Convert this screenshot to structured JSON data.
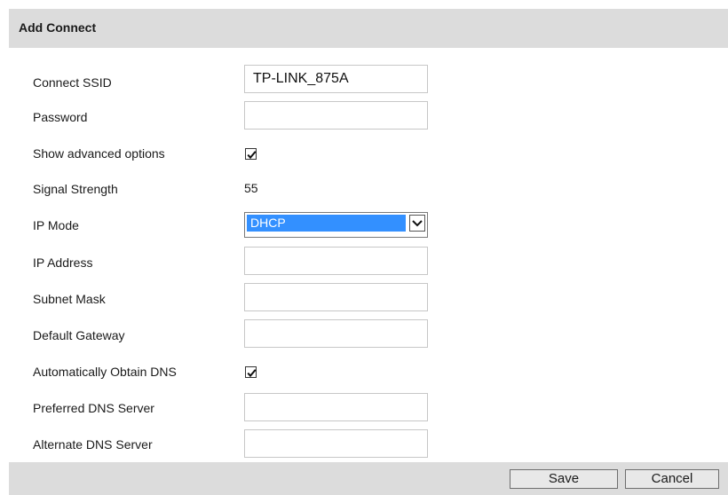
{
  "dialog": {
    "title": "Add Connect"
  },
  "form": {
    "ssid": {
      "label": "Connect SSID",
      "value": "TP-LINK_875A"
    },
    "password": {
      "label": "Password",
      "value": ""
    },
    "show_advanced": {
      "label": "Show advanced options",
      "checked": true
    },
    "signal_strength": {
      "label": "Signal Strength",
      "value": "55"
    },
    "ip_mode": {
      "label": "IP Mode",
      "value": "DHCP",
      "options": [
        "DHCP"
      ]
    },
    "ip_address": {
      "label": "IP Address",
      "value": ""
    },
    "subnet_mask": {
      "label": "Subnet Mask",
      "value": ""
    },
    "default_gateway": {
      "label": "Default Gateway",
      "value": ""
    },
    "auto_dns": {
      "label": "Automatically Obtain DNS",
      "checked": true
    },
    "preferred_dns": {
      "label": "Preferred DNS Server",
      "value": ""
    },
    "alternate_dns": {
      "label": "Alternate DNS Server",
      "value": ""
    }
  },
  "footer": {
    "save_label": "Save",
    "cancel_label": "Cancel"
  },
  "icons": {
    "checkbox_check": "check-icon",
    "select_arrow": "chevron-down-icon"
  },
  "colors": {
    "header_bg": "#dcdcdc",
    "selection_bg": "#3390ff"
  }
}
